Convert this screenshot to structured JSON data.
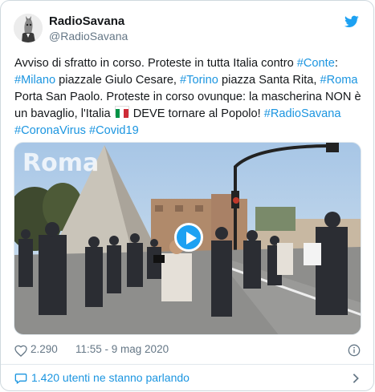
{
  "user": {
    "name": "RadioSavana",
    "handle": "@RadioSavana"
  },
  "tweet": {
    "segments": [
      {
        "text": "Avviso di sfratto in corso. Proteste in tutta Italia contro ",
        "type": "text"
      },
      {
        "text": "#Conte",
        "type": "link"
      },
      {
        "text": ": ",
        "type": "text"
      },
      {
        "text": "#Milano",
        "type": "link"
      },
      {
        "text": " piazzale Giulo Cesare, ",
        "type": "text"
      },
      {
        "text": "#Torino",
        "type": "link"
      },
      {
        "text": " piazza Santa Rita, ",
        "type": "text"
      },
      {
        "text": "#Roma",
        "type": "link"
      },
      {
        "text": " Porta San Paolo. Proteste in corso ovunque: la mascherina NON è un bavaglio, l'Italia ",
        "type": "text"
      },
      {
        "text": "",
        "type": "flag"
      },
      {
        "text": " DEVE tornare al Popolo! ",
        "type": "text"
      },
      {
        "text": "#RadioSavana",
        "type": "link"
      },
      {
        "text": " ",
        "type": "text"
      },
      {
        "text": "#CoronaVirus",
        "type": "link"
      },
      {
        "text": " ",
        "type": "text"
      },
      {
        "text": "#Covid19",
        "type": "link"
      }
    ]
  },
  "video": {
    "watermark": "Roma",
    "play_icon": "play-icon"
  },
  "meta": {
    "likes": "2.290",
    "timestamp": "11:55 - 9 mag 2020",
    "heart_icon": "heart-icon",
    "info_icon": "info-icon"
  },
  "footer": {
    "label": "1.420 utenti ne stanno parlando",
    "chat_icon": "chat-bubble-icon",
    "chevron_icon": "chevron-right-icon"
  },
  "colors": {
    "link": "#1b95e0",
    "twitter_blue": "#1da1f2",
    "muted": "#657786",
    "text": "#14171a",
    "flag_green": "#009246",
    "flag_white": "#ffffff",
    "flag_red": "#ce2b37"
  }
}
